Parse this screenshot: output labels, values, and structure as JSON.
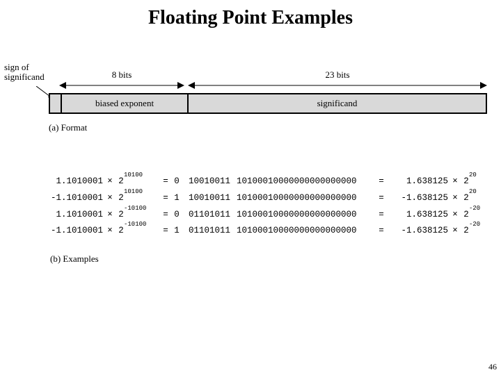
{
  "title": "Floating Point Examples",
  "format": {
    "sign_label_line1": "sign of",
    "sign_label_line2": "significand",
    "width_8_label": "8 bits",
    "width_23_label": "23 bits",
    "exp_box_label": "biased exponent",
    "sig_box_label": "significand",
    "caption": "(a) Format"
  },
  "examples": {
    "caption": "(b) Examples",
    "rows": [
      {
        "mant": "1.1010001",
        "exp_in": "10100",
        "s": "0",
        "e": "10010011",
        "f": "10100010000000000000000",
        "dec": "1.638125",
        "exp_out": "20"
      },
      {
        "mant": "-1.1010001",
        "exp_in": "10100",
        "s": "1",
        "e": "10010011",
        "f": "10100010000000000000000",
        "dec": "-1.638125",
        "exp_out": "20"
      },
      {
        "mant": "1.1010001",
        "exp_in": "-10100",
        "s": "0",
        "e": "01101011",
        "f": "10100010000000000000000",
        "dec": "1.638125",
        "exp_out": "-20"
      },
      {
        "mant": "-1.1010001",
        "exp_in": "-10100",
        "s": "1",
        "e": "01101011",
        "f": "10100010000000000000000",
        "dec": "-1.638125",
        "exp_out": "-20"
      }
    ]
  },
  "glyphs": {
    "times": "×",
    "equals": "=",
    "two": "2"
  },
  "page_number": "46"
}
